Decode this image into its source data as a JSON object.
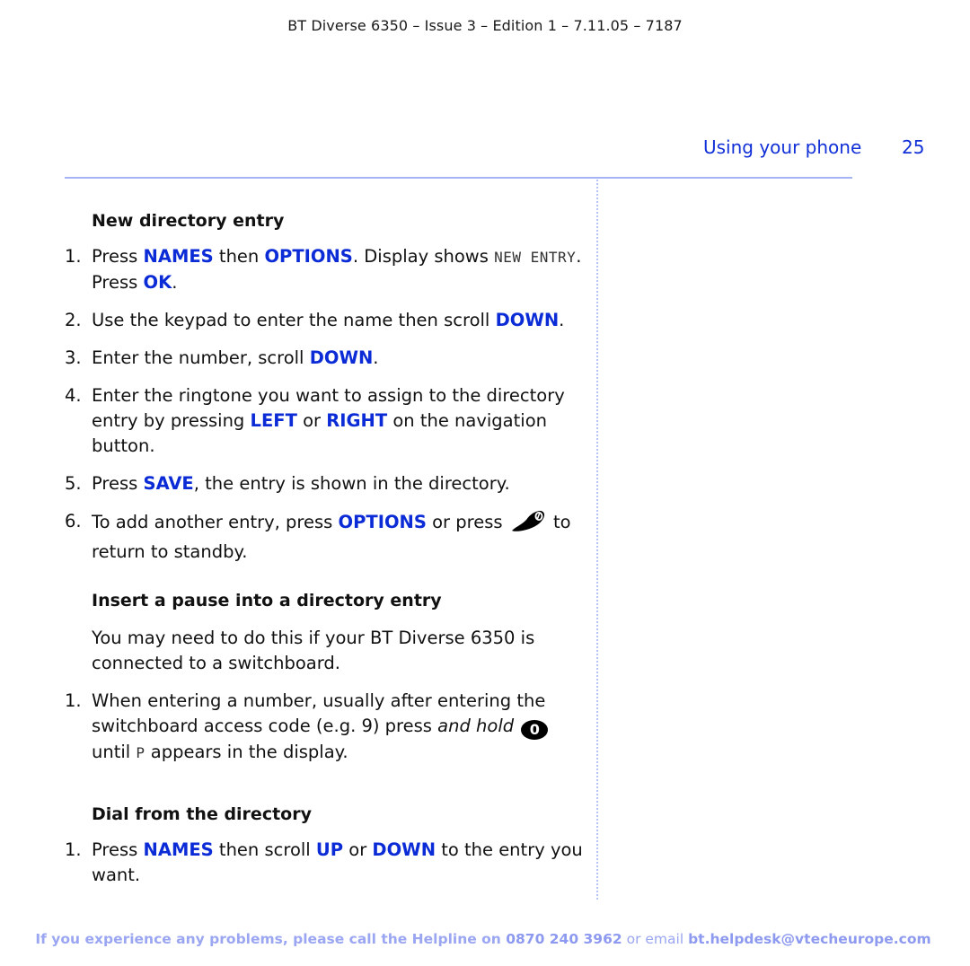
{
  "header": {
    "doc_info": "BT Diverse 6350 – Issue 3 – Edition 1 – 7.11.05 – 7187",
    "section": "Using your phone",
    "page_number": "25"
  },
  "sections": {
    "new_entry": {
      "heading": "New directory entry",
      "steps": [
        {
          "num": "1.",
          "parts": [
            "Press ",
            "NAMES",
            " then ",
            "OPTIONS",
            ". Display shows ",
            "NEW ENTRY",
            ". Press ",
            "OK",
            "."
          ]
        },
        {
          "num": "2.",
          "parts": [
            "Use the keypad to enter the name then scroll ",
            "DOWN",
            "."
          ]
        },
        {
          "num": "3.",
          "parts": [
            "Enter the number, scroll ",
            "DOWN",
            "."
          ]
        },
        {
          "num": "4.",
          "parts": [
            "Enter the ringtone you want to assign to the directory entry by pressing ",
            "LEFT",
            " or ",
            "RIGHT",
            " on the navigation button."
          ]
        },
        {
          "num": "5.",
          "parts": [
            "Press ",
            "SAVE",
            ", the entry is shown in the directory."
          ]
        },
        {
          "num": "6.",
          "parts": [
            "To add another entry, press ",
            "OPTIONS",
            " or press ",
            "to return to standby."
          ]
        }
      ]
    },
    "pause": {
      "heading": "Insert a pause into a directory entry",
      "intro": "You may need to do this if your BT Diverse 6350 is connected to a switchboard.",
      "steps": [
        {
          "num": "1.",
          "parts": [
            "When entering a number, usually after entering the switchboard access code (e.g. 9) press ",
            "and hold",
            "0",
            " until ",
            "P",
            " appears in the display."
          ]
        }
      ]
    },
    "dial": {
      "heading": "Dial from the directory",
      "steps": [
        {
          "num": "1.",
          "parts": [
            "Press ",
            "NAMES",
            " then scroll ",
            "UP",
            " or ",
            "DOWN",
            " to the entry you want."
          ]
        }
      ]
    }
  },
  "footer": {
    "text1": "If you experience any problems, please call the Helpline on ",
    "phone": "0870 240 3962",
    "text2": " or email ",
    "email": "bt.helpdesk@vtecheurope.com"
  },
  "icons": {
    "end_call": "end-call-icon",
    "zero_key": "zero-key-icon"
  },
  "colors": {
    "accent_blue": "#0a2bd6",
    "rule_blue": "#a7b3f7",
    "footer_blue": "#9aa6f2"
  }
}
